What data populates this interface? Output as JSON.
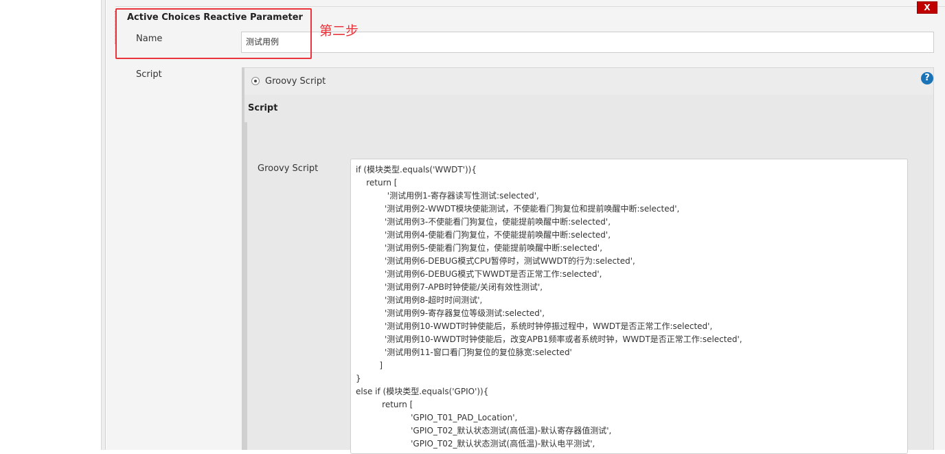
{
  "parameter": {
    "title": "Active Choices Reactive Parameter",
    "delete_label": "X",
    "annotation": "第二步",
    "name_label": "Name",
    "name_value": "测试用例",
    "script_label": "Script",
    "script_type_option": "Groovy Script",
    "help_label": "?",
    "script_section_heading": "Script",
    "groovy_script_label": "Groovy Script",
    "code_lines": [
      "if (模块类型.equals('WWDT')){",
      "    return [",
      "            '测试用例1-寄存器读写性测试:selected',",
      "           '测试用例2-WWDT模块使能测试，不使能看门狗复位和提前唤醒中断:selected',",
      "           '测试用例3-不使能看门狗复位，使能提前唤醒中断:selected',",
      "           '测试用例4-使能看门狗复位，不使能提前唤醒中断:selected',",
      "           '测试用例5-使能看门狗复位，使能提前唤醒中断:selected',",
      "           '测试用例6-DEBUG模式CPU暂停时，测试WWDT的行为:selected',",
      "           '测试用例6-DEBUG模式下WWDT是否正常工作:selected',",
      "           '测试用例7-APB时钟使能/关闭有效性测试',",
      "           '测试用例8-超时时间测试',",
      "           '测试用例9-寄存器复位等级测试:selected',",
      "           '测试用例10-WWDT时钟使能后，系统时钟停振过程中，WWDT是否正常工作:selected',",
      "           '测试用例10-WWDT时钟使能后，改变APB1频率或者系统时钟，WWDT是否正常工作:selected',",
      "           '测试用例11-窗口看门狗复位的复位脉宽:selected'",
      "         ]",
      "}",
      "else if (模块类型.equals('GPIO')){",
      "          return [",
      "                     'GPIO_T01_PAD_Location',",
      "                     'GPIO_T02_默认状态测试(高低温)-默认寄存器值测试',",
      "                     'GPIO_T02_默认状态测试(高低温)-默认电平测试',"
    ]
  }
}
